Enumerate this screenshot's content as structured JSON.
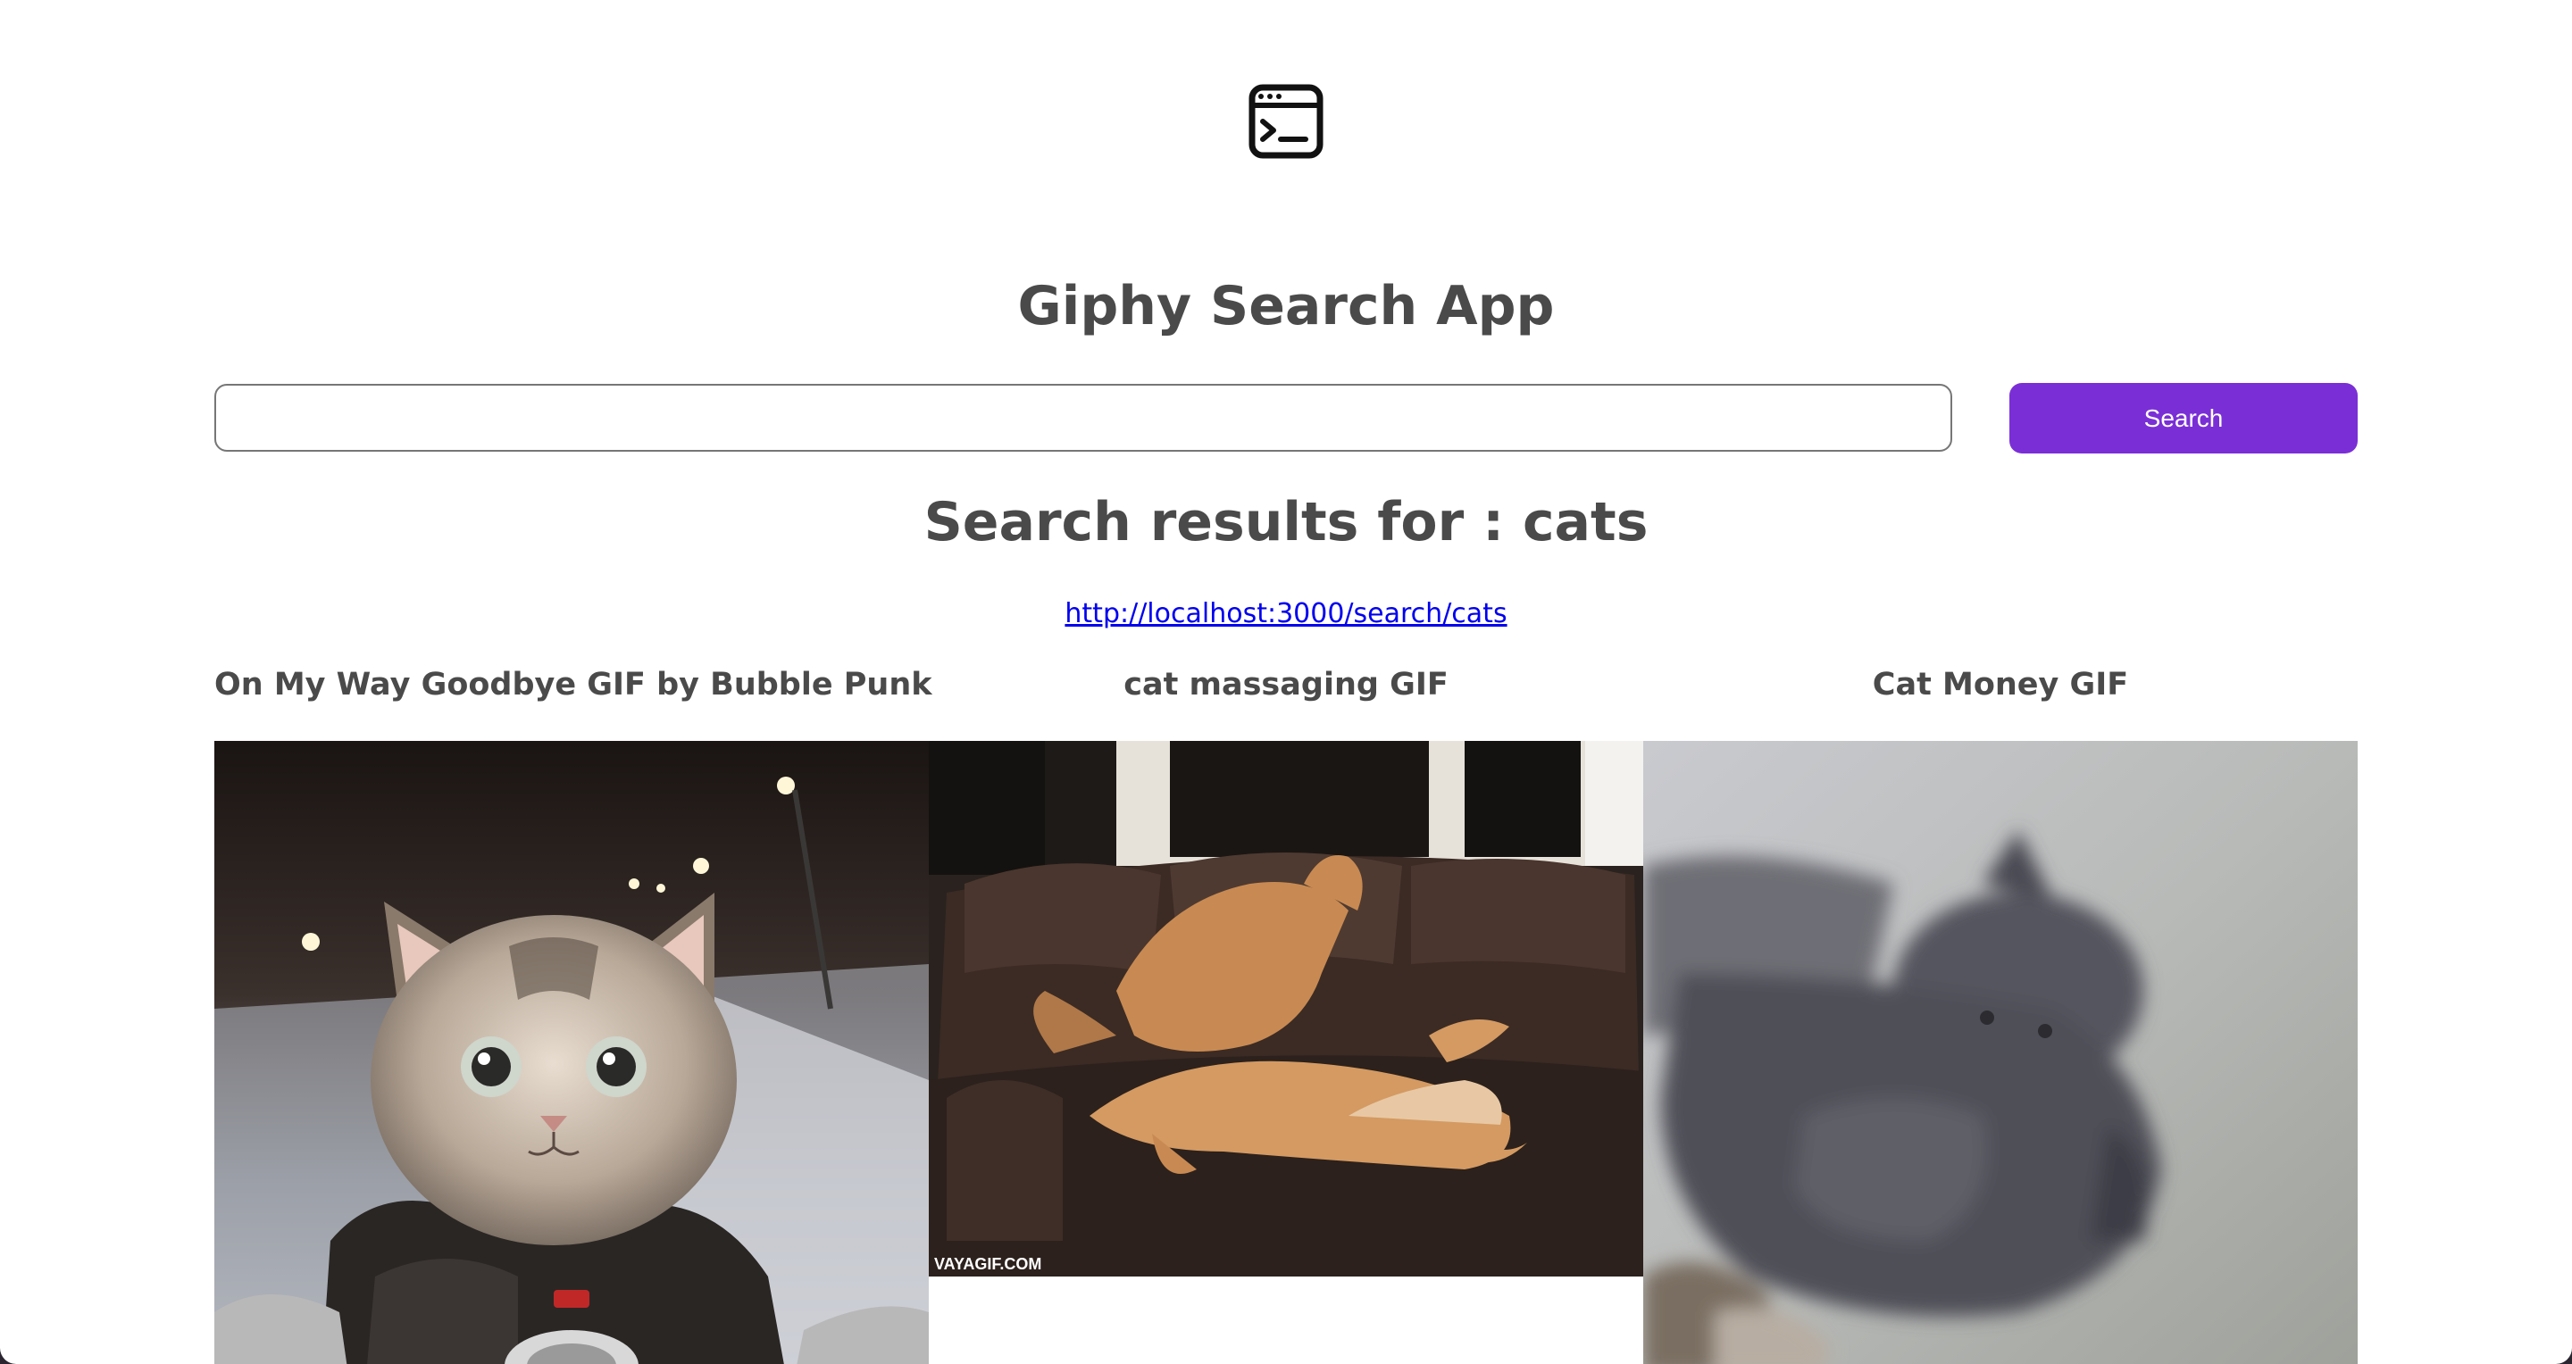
{
  "header": {
    "logo_icon": "terminal-window-icon",
    "title": "Giphy Search App"
  },
  "search": {
    "value": "",
    "placeholder": "",
    "button_label": "Search",
    "button_color": "#7a2fd6"
  },
  "results": {
    "heading": "Search results for : cats",
    "link": "http://localhost:3000/search/cats"
  },
  "gifs": [
    {
      "title": "On My Way Goodbye GIF by Bubble Punk",
      "image": "kitten-riding-motorcycle"
    },
    {
      "title": "cat massaging GIF",
      "image": "cat-massaging-cat-on-couch",
      "watermark": "VAYAGIF.COM"
    },
    {
      "title": "Cat Money GIF",
      "image": "gray-cat-blurred"
    }
  ]
}
